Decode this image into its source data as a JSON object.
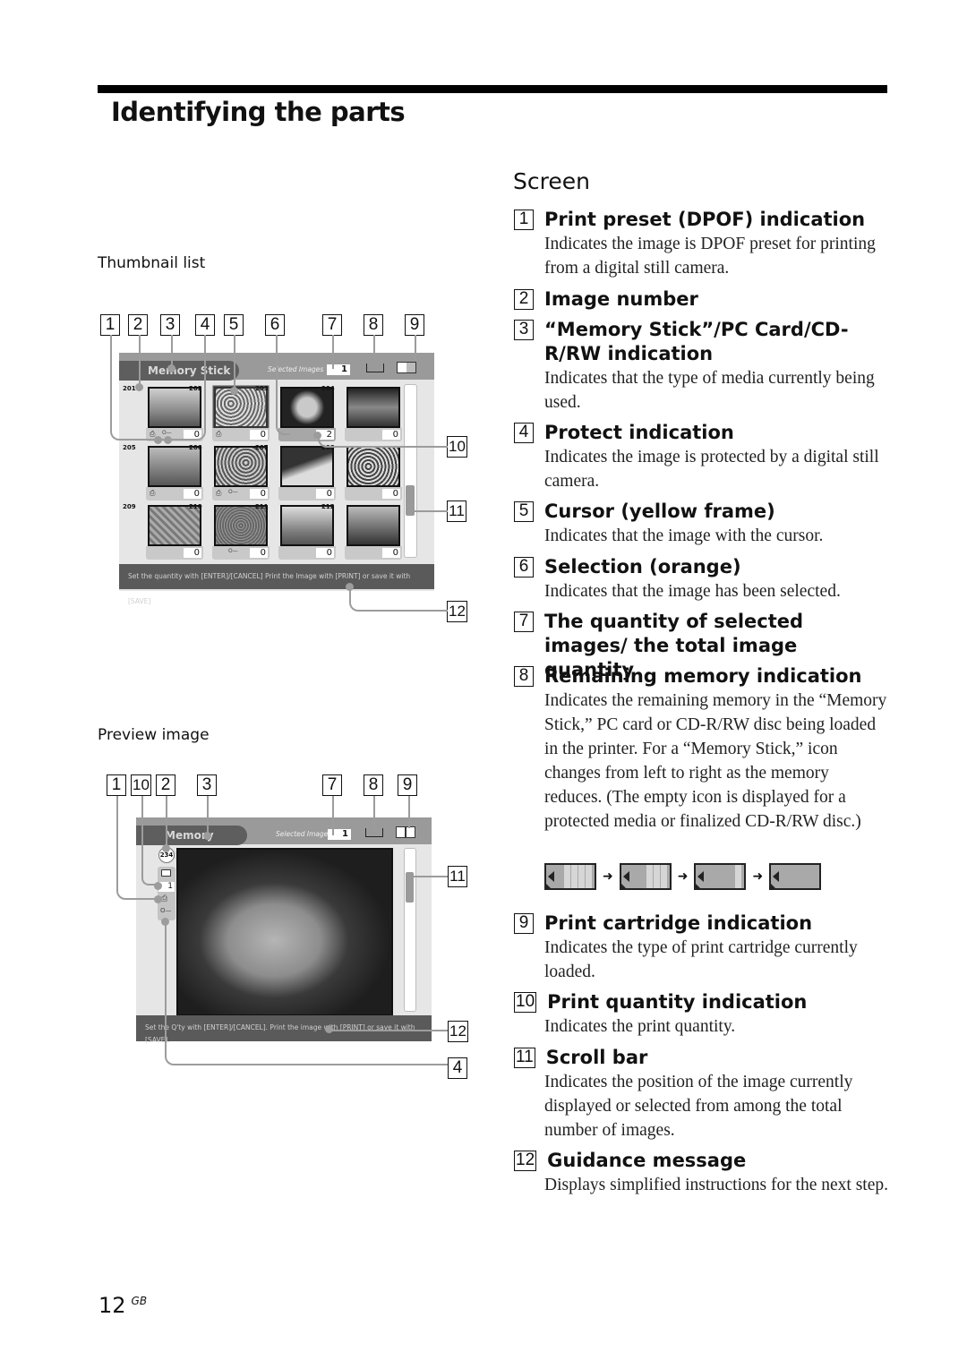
{
  "page": {
    "title": "Identifying the parts",
    "page_number": "12",
    "page_suffix": "GB"
  },
  "figures": {
    "thumbnail": {
      "caption": "Thumbnail list",
      "callouts_top": [
        "1",
        "2",
        "3",
        "4",
        "5",
        "6",
        "7",
        "8",
        "9"
      ],
      "callouts_right": [
        "10",
        "11",
        "12"
      ],
      "media_label": "Memory Stick",
      "selected_label": "Selected Images",
      "selected_count": "1",
      "thumbnails": [
        {
          "num": "201",
          "qty": "0",
          "dpof": true,
          "protect": true
        },
        {
          "num": "202",
          "qty": "0",
          "dpof": true,
          "protect": false,
          "cursor": true
        },
        {
          "num": "203",
          "qty": "2",
          "dpof": false,
          "protect": false,
          "selected": true
        },
        {
          "num": "204",
          "qty": "0",
          "dpof": false,
          "protect": false
        },
        {
          "num": "205",
          "qty": "0",
          "dpof": true,
          "protect": false
        },
        {
          "num": "206",
          "qty": "0",
          "dpof": true,
          "protect": true
        },
        {
          "num": "207",
          "qty": "0",
          "dpof": false,
          "protect": false
        },
        {
          "num": "208",
          "qty": "0",
          "dpof": false,
          "protect": false
        },
        {
          "num": "209",
          "qty": "0",
          "dpof": false,
          "protect": false
        },
        {
          "num": "210",
          "qty": "0",
          "dpof": false,
          "protect": true
        },
        {
          "num": "211",
          "qty": "0",
          "dpof": false,
          "protect": false
        },
        {
          "num": "212",
          "qty": "0",
          "dpof": false,
          "protect": false
        }
      ],
      "guidance": "Set the quantity with [ENTER]/[CANCEL] Print the Image with [PRINT] or save it with [SAVE]"
    },
    "preview": {
      "caption": "Preview image",
      "callouts_top": [
        "1",
        "10",
        "2",
        "3",
        "7",
        "8",
        "9"
      ],
      "callouts_right": [
        "11",
        "12",
        "4"
      ],
      "media_label": "Memory Stick",
      "selected_label": "Selected Images",
      "selected_count": "1",
      "image_number": "234",
      "print_qty": "1",
      "guidance": "Set the Q'ty with [ENTER]/[CANCEL]. Print the image with [PRINT] or save it with [SAVE]."
    }
  },
  "screen_section": {
    "title": "Screen",
    "items": [
      {
        "n": "1",
        "title": "Print preset (DPOF) indication",
        "desc": "Indicates the image is DPOF preset for printing from a digital still camera."
      },
      {
        "n": "2",
        "title": "Image number",
        "desc": ""
      },
      {
        "n": "3",
        "title": "“Memory Stick”/PC Card/CD-R/RW indication",
        "desc": "Indicates that the type of media currently being used."
      },
      {
        "n": "4",
        "title": "Protect indication",
        "desc": "Indicates the image is protected by a digital still camera."
      },
      {
        "n": "5",
        "title": "Cursor (yellow frame)",
        "desc": "Indicates that the image with the cursor."
      },
      {
        "n": "6",
        "title": "Selection (orange)",
        "desc": "Indicates that the image has been selected."
      },
      {
        "n": "7",
        "title": "The quantity of selected images/ the total image quantity",
        "desc": ""
      },
      {
        "n": "8",
        "title": "Remaining memory indication",
        "desc": "Indicates the remaining memory in the “Memory Stick,” PC card or CD-R/RW disc being loaded in the printer.  For a “Memory Stick,” icon changes from left to right as the memory reduces.  (The empty icon is displayed for a protected media or finalized CD-R/RW disc.)"
      },
      {
        "n": "9",
        "title": "Print cartridge indication",
        "desc": "Indicates the type of print cartridge currently loaded."
      },
      {
        "n": "10",
        "title": "Print quantity indication",
        "desc": "Indicates the print quantity."
      },
      {
        "n": "11",
        "title": "Scroll bar",
        "desc": "Indicates the position of the image currently displayed or selected from among the total number of images."
      },
      {
        "n": "12",
        "title": "Guidance message",
        "desc": "Displays simplified instructions for the next step."
      }
    ],
    "memory_levels": [
      4,
      3,
      1,
      0
    ]
  }
}
